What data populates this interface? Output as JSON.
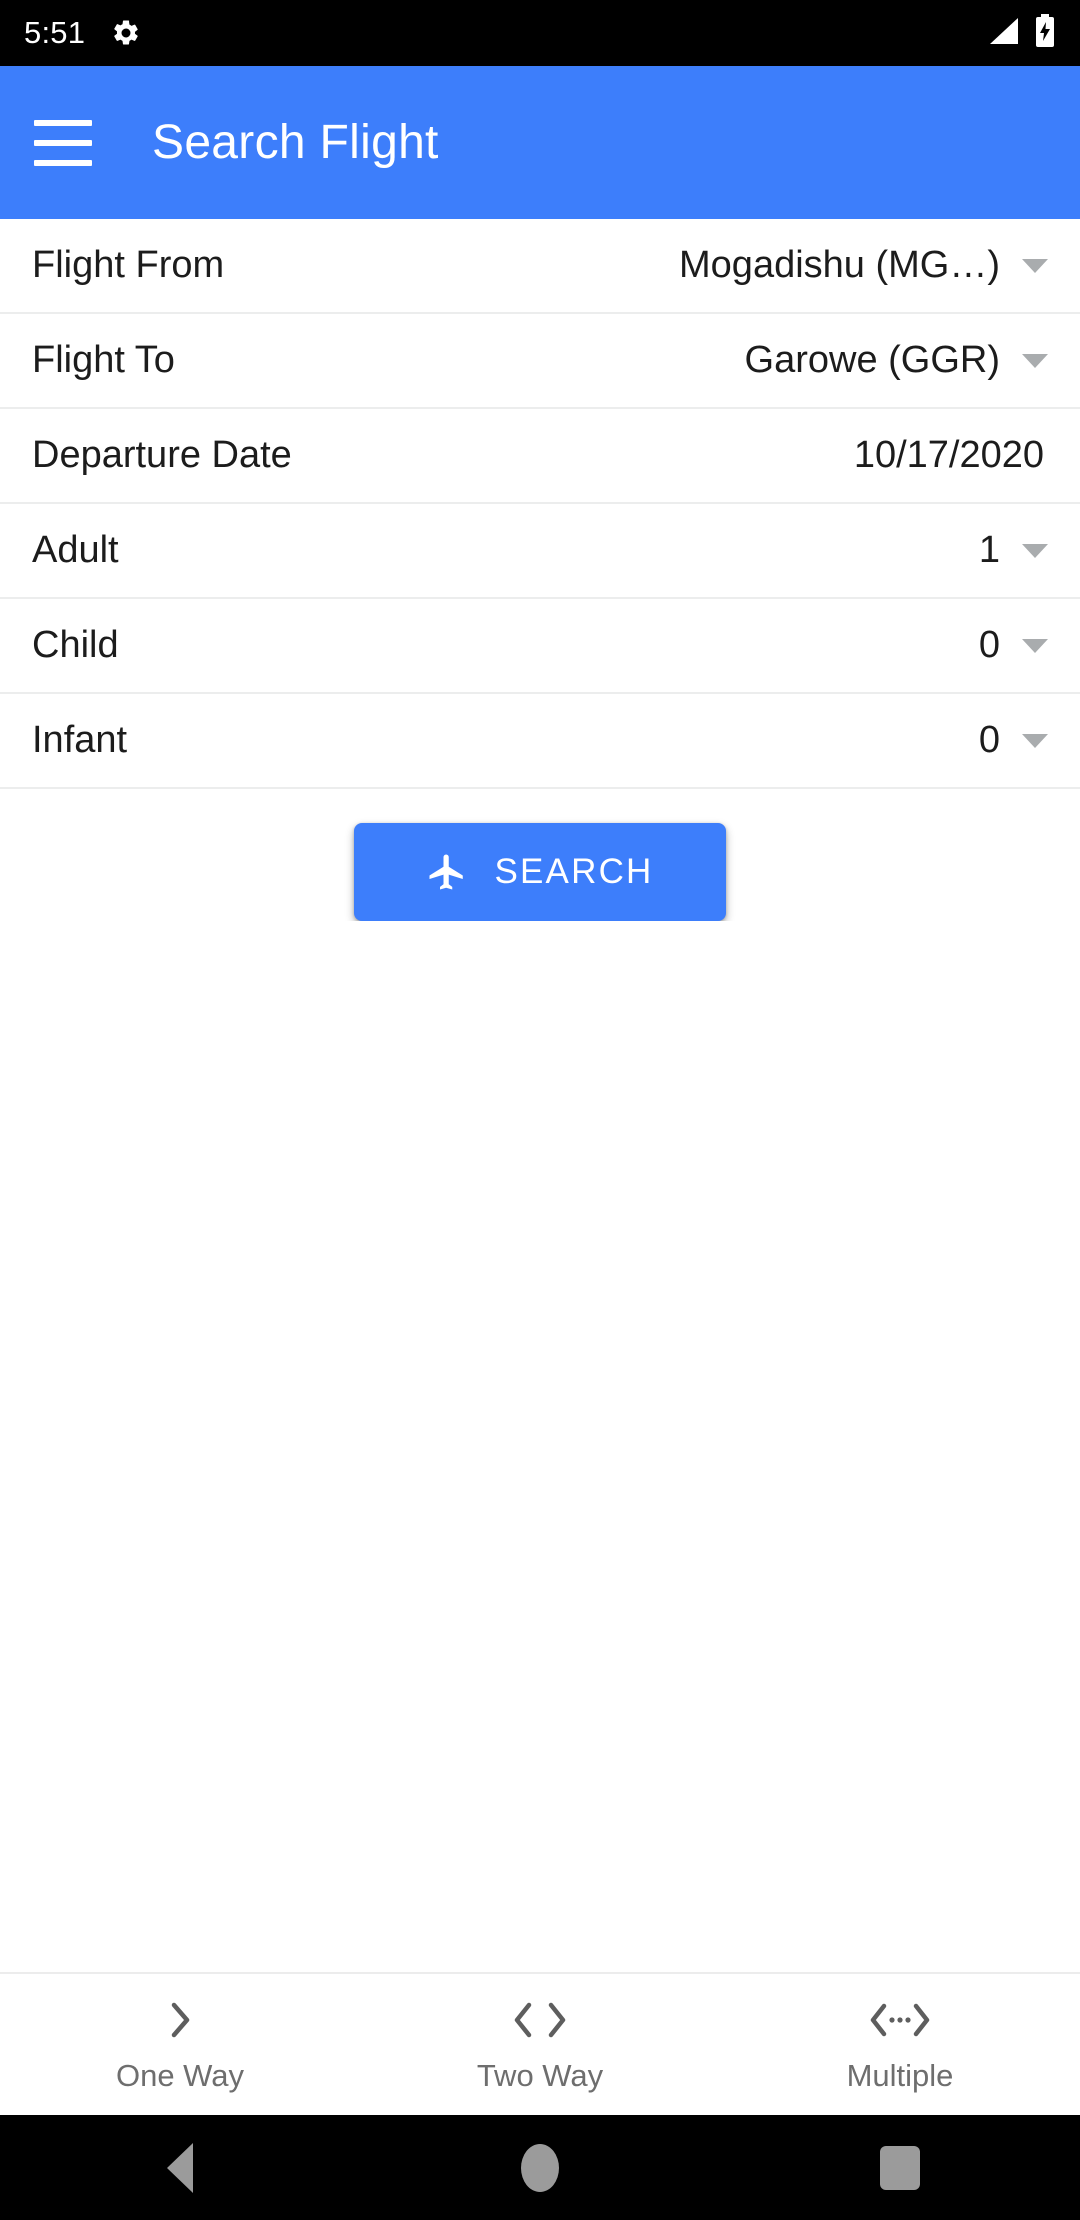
{
  "status_bar": {
    "time": "5:51",
    "gear_icon": "gear-icon",
    "signal_icon": "signal-triangle-icon",
    "battery_icon": "battery-charging-icon"
  },
  "app_bar": {
    "menu_icon": "hamburger-menu-icon",
    "title": "Search Flight",
    "background_color": "#3d7efb"
  },
  "form": {
    "rows": [
      {
        "label": "Flight From",
        "value": "Mogadishu (MG…)",
        "has_caret": true,
        "name": "flight-from"
      },
      {
        "label": "Flight To",
        "value": "Garowe (GGR)",
        "has_caret": true,
        "name": "flight-to"
      },
      {
        "label": "Departure Date",
        "value": "10/17/2020",
        "has_caret": false,
        "name": "departure-date"
      },
      {
        "label": "Adult",
        "value": "1",
        "has_caret": true,
        "name": "adult-count"
      },
      {
        "label": "Child",
        "value": "0",
        "has_caret": true,
        "name": "child-count"
      },
      {
        "label": "Infant",
        "value": "0",
        "has_caret": true,
        "name": "infant-count"
      }
    ]
  },
  "search_button": {
    "label": "SEARCH",
    "icon": "airplane-icon",
    "color": "#3d7efb"
  },
  "bottom_tabs": {
    "items": [
      {
        "label": "One Way",
        "icon": "chevron-right-icon"
      },
      {
        "label": "Two Way",
        "icon": "chevron-left-right-icon"
      },
      {
        "label": "Multiple",
        "icon": "code-dots-icon"
      }
    ]
  },
  "android_nav": {
    "back": "back-triangle-icon",
    "home": "home-circle-icon",
    "recents": "recents-square-icon"
  }
}
